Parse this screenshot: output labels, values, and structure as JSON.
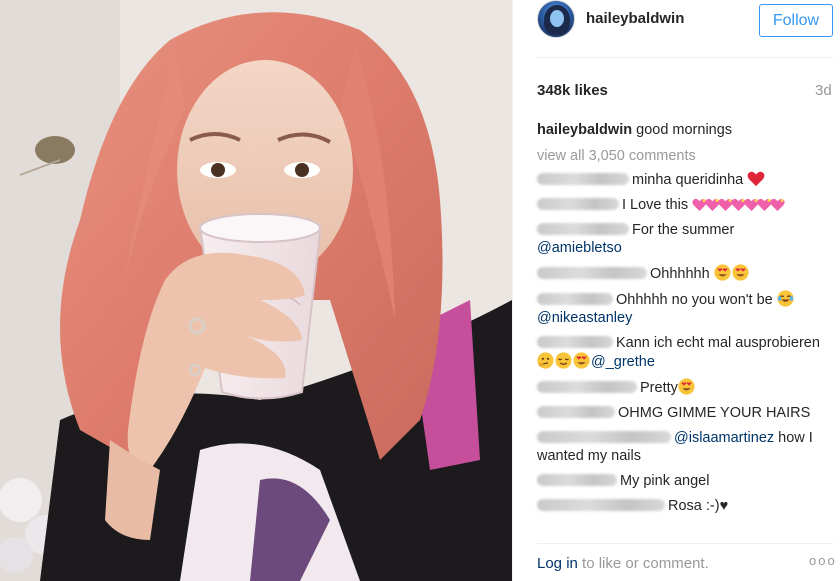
{
  "post": {
    "username": "haileybaldwin",
    "follow_label": "Follow",
    "likes": "348k likes",
    "time_ago": "3d",
    "caption_user": "haileybaldwin",
    "caption_text": "good mornings",
    "view_all": "view all 3,050 comments",
    "login_link": "Log in",
    "login_rest": " to like or comment.",
    "more_icon": "ooo"
  },
  "comments": [
    {
      "text": "minha queridinha "
    },
    {
      "text": "I Love this "
    },
    {
      "text": "For the summer ",
      "mention": "@amiebletso"
    },
    {
      "text": "Ohhhhhh "
    },
    {
      "text": "Ohhhhh no you won't be ",
      "mention": "@nikeastanley"
    },
    {
      "text": "Kann ich echt mal ausprobieren ",
      "mention": "@_grethe"
    },
    {
      "text": "Pretty"
    },
    {
      "text": "OHMG GIMME YOUR HAIRS"
    },
    {
      "mention": "@islaamartinez",
      "text": " how I wanted my nails"
    },
    {
      "text": "My pink angel"
    },
    {
      "text": "Rosa :-)♥"
    }
  ],
  "icons": {
    "red_heart": "red-heart-emoji",
    "pink_heart": "sparkling-heart-emoji",
    "heart_eyes": "heart-eyes-emoji",
    "laughing": "tears-of-joy-emoji",
    "thinking": "thinking-emoji",
    "relieved": "relieved-emoji"
  },
  "colors": {
    "accent": "#3897f0",
    "mention": "#003569",
    "muted": "#999999",
    "text": "#262626"
  }
}
